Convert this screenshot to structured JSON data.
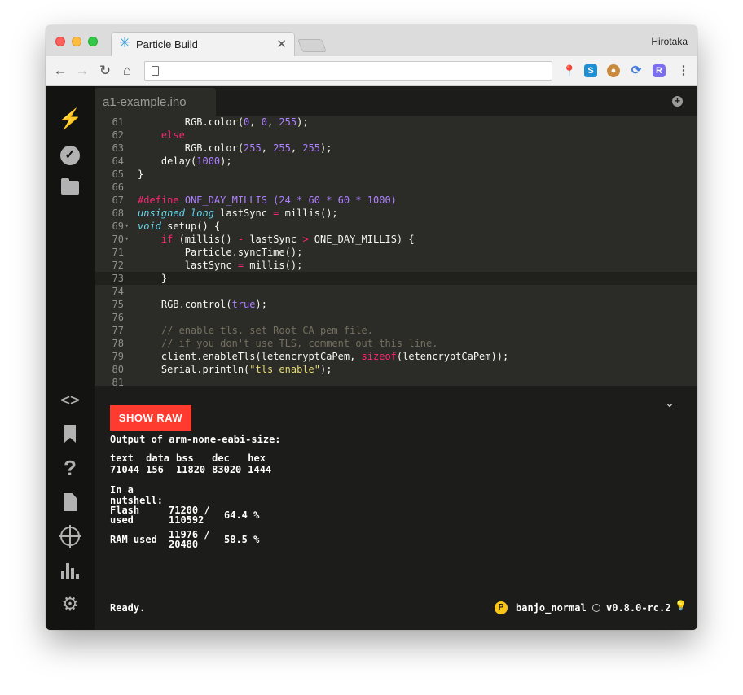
{
  "browser": {
    "tab_title": "Particle Build",
    "profile_name": "Hirotaka",
    "address": ""
  },
  "editor": {
    "file_tab": "a1-example.ino",
    "current_line": 73
  },
  "code_lines": [
    {
      "n": "61",
      "f": "",
      "html": "        RGB.color(<span class=\"n\">0</span>, <span class=\"n\">0</span>, <span class=\"n\">255</span>);"
    },
    {
      "n": "62",
      "f": "",
      "html": "    <span class=\"k\">else</span>"
    },
    {
      "n": "63",
      "f": "",
      "html": "        RGB.color(<span class=\"n\">255</span>, <span class=\"n\">255</span>, <span class=\"n\">255</span>);"
    },
    {
      "n": "64",
      "f": "",
      "html": "    delay(<span class=\"n\">1000</span>);"
    },
    {
      "n": "65",
      "f": "",
      "html": "}"
    },
    {
      "n": "66",
      "f": "",
      "html": ""
    },
    {
      "n": "67",
      "f": "",
      "html": "<span class=\"k\">#define</span> <span class=\"n\">ONE_DAY_MILLIS (24 * 60 * 60 * 1000)</span>"
    },
    {
      "n": "68",
      "f": "",
      "html": "<span class=\"s\">unsigned long</span> lastSync <span class=\"k\">=</span> millis();"
    },
    {
      "n": "69",
      "f": "▾",
      "html": "<span class=\"s\">void</span> setup() {"
    },
    {
      "n": "70",
      "f": "▾",
      "html": "    <span class=\"k\">if</span> (millis() <span class=\"k\">-</span> lastSync <span class=\"k\">&gt;</span> ONE_DAY_MILLIS) {"
    },
    {
      "n": "71",
      "f": "",
      "html": "        Particle.syncTime();"
    },
    {
      "n": "72",
      "f": "",
      "html": "        lastSync <span class=\"k\">=</span> millis();"
    },
    {
      "n": "73",
      "f": "",
      "html": "    }"
    },
    {
      "n": "74",
      "f": "",
      "html": ""
    },
    {
      "n": "75",
      "f": "",
      "html": "    RGB.control(<span class=\"n\">true</span>);"
    },
    {
      "n": "76",
      "f": "",
      "html": ""
    },
    {
      "n": "77",
      "f": "",
      "html": "    <span class=\"c\">// enable tls. set Root CA pem file.</span>"
    },
    {
      "n": "78",
      "f": "",
      "html": "    <span class=\"c\">// if you don't use TLS, comment out this line.</span>"
    },
    {
      "n": "79",
      "f": "",
      "html": "    client.enableTls(letencryptCaPem, <span class=\"k\">sizeof</span>(letencryptCaPem));"
    },
    {
      "n": "80",
      "f": "",
      "html": "    Serial.println(<span class=\"y\">\"tls enable\"</span>);"
    },
    {
      "n": "81",
      "f": "",
      "html": ""
    }
  ],
  "console": {
    "show_raw_label": "SHOW RAW",
    "output_header": "Output of arm-none-eabi-size:",
    "size_headers": [
      "text",
      "data",
      "bss",
      "dec",
      "hex"
    ],
    "size_values": [
      "71044",
      "156",
      "11820",
      "83020",
      "1444"
    ],
    "nutshell_title": "In a nutshell:",
    "flash_label": "Flash used",
    "flash_value": "71200 / 110592",
    "flash_pct": "64.4 %",
    "ram_label": "RAM used",
    "ram_value": "11976 / 20480",
    "ram_pct": "58.5 %",
    "status": "Ready."
  },
  "device": {
    "badge": "P",
    "name": "banjo_normal",
    "firmware": "v0.8.0-rc.2"
  },
  "icons": {
    "sidebar": [
      "flash-icon",
      "verify-icon",
      "folder-icon",
      "code-icon",
      "libraries-icon",
      "help-icon",
      "docs-icon",
      "console-icon",
      "reports-icon",
      "settings-icon"
    ]
  }
}
